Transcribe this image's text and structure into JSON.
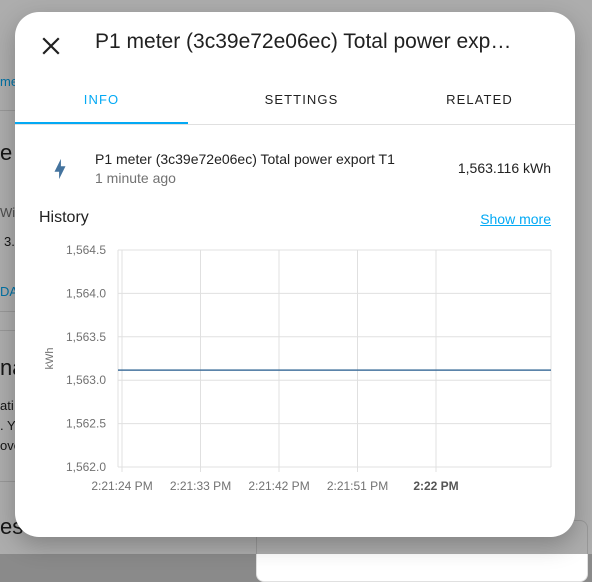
{
  "background": {
    "fragments": [
      "me",
      "e",
      "Wiz",
      "3.",
      "DA",
      "na",
      "ati",
      ". Y",
      "ove",
      "es"
    ]
  },
  "dialog": {
    "title": "P1 meter (3c39e72e06ec) Total power exp…",
    "close_icon": "close-icon",
    "tabs": [
      {
        "label": "INFO",
        "active": true
      },
      {
        "label": "SETTINGS",
        "active": false
      },
      {
        "label": "RELATED",
        "active": false
      }
    ],
    "state": {
      "icon": "lightning-bolt-icon",
      "name": "P1 meter (3c39e72e06ec) Total power export T1",
      "last_changed": "1 minute ago",
      "value": "1,563.116 kWh"
    },
    "history": {
      "title": "History",
      "show_more": "Show more"
    }
  },
  "colors": {
    "accent": "#03a9f4",
    "line": "#44739e",
    "icon": "#44739e"
  },
  "chart_data": {
    "type": "line",
    "ylabel": "kWh",
    "ylim": [
      1562.0,
      1564.5
    ],
    "yticks": [
      "1,564.5",
      "1,564.0",
      "1,563.5",
      "1,563.0",
      "1,562.5",
      "1,562.0"
    ],
    "ytick_values": [
      1564.5,
      1564.0,
      1563.5,
      1563.0,
      1562.5,
      1562.0
    ],
    "xticks": [
      "2:21:24 PM",
      "2:21:33 PM",
      "2:21:42 PM",
      "2:21:51 PM",
      "2:22 PM"
    ],
    "xtick_bold": [
      false,
      false,
      false,
      false,
      true
    ],
    "series": [
      {
        "values": [
          1563.116,
          1563.116
        ]
      }
    ]
  }
}
